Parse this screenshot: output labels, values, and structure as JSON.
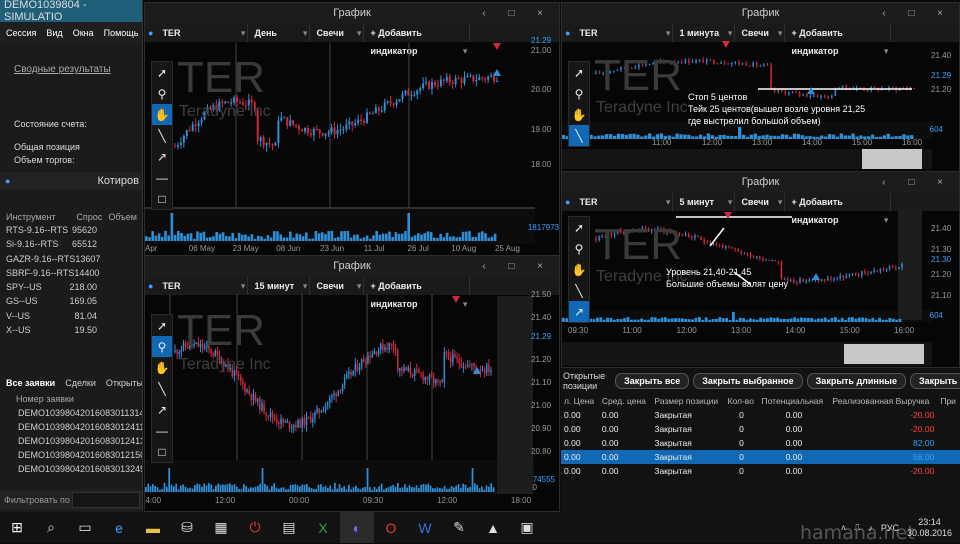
{
  "app": {
    "title": "DEMO1039804 - SIMULATIO",
    "menu": [
      "Сессия",
      "Вид",
      "Окна",
      "Помощь"
    ]
  },
  "left": {
    "summary_link": "Сводные результаты",
    "account_state": "Состояние счета:",
    "total_position": "Общая позиция",
    "trade_volume": "Объем торгов:",
    "quotes_title": "Котиров",
    "quotes_headers": [
      "Инструмент",
      "Спрос",
      "Объем"
    ],
    "quotes": [
      {
        "inst": "RTS-9.16--RTS",
        "bid": "95620"
      },
      {
        "inst": "Si-9.16--RTS",
        "bid": "65512"
      },
      {
        "inst": "GAZR-9.16--RTS",
        "bid": "13607"
      },
      {
        "inst": "SBRF-9.16--RTS",
        "bid": "14400"
      },
      {
        "inst": "SPY--US",
        "bid": "218.00"
      },
      {
        "inst": "GS--US",
        "bid": "169.05"
      },
      {
        "inst": "V--US",
        "bid": "81.04"
      },
      {
        "inst": "X--US",
        "bid": "19.50"
      }
    ],
    "orders_tabs": [
      "Все заявки",
      "Сделки",
      "Открытые"
    ],
    "orders_header": "Номер заявки",
    "orders": [
      "DEMO10398042016083011314",
      "DEMO10398042016083012411",
      "DEMO10398042016083012413",
      "DEMO10398042016083012150",
      "DEMO10398042016083013245"
    ],
    "filter_label": "Фильтровать по"
  },
  "charts": {
    "window_title": "График",
    "add_indicator": "+ Добавить индикатор",
    "candles": "Свечи",
    "symbol": "TER",
    "company": "Teradyne Inc",
    "c1": {
      "period": "День",
      "yticks": [
        "21.00",
        "20.00",
        "19.00",
        "18.00"
      ],
      "price": "21.29",
      "vol": "1817973",
      "xticks": [
        "Apr",
        "06 May",
        "23 May",
        "08 Jun",
        "23 Jun",
        "11 Jul",
        "26 Jul",
        "10 Aug",
        "25 Aug"
      ]
    },
    "c2": {
      "period": "15 минут",
      "yticks": [
        "21.50",
        "21.40",
        "21.30",
        "21.20",
        "21.10",
        "21.00",
        "20.90",
        "20.80"
      ],
      "price": "21.29",
      "vol": "74555",
      "vol_zero": "0",
      "xticks": [
        "14:00",
        "12:00",
        "00:00",
        "09:30",
        "12:00",
        "18:00"
      ]
    },
    "c3": {
      "period": "1 минута",
      "yticks": [
        "21.40",
        "21.30",
        "21.20"
      ],
      "price": "21.29",
      "vol": "604",
      "xticks": [
        "11:00",
        "12:00",
        "13:00",
        "14:00",
        "15:00",
        "16:00"
      ],
      "note": [
        "Стоп 5 центов",
        "Тейк 25 центов(вышел возле уровня 21,25",
        "где выстрелил большой объем)"
      ]
    },
    "c4": {
      "period": "5 минут",
      "yticks": [
        "21.40",
        "21.30",
        "21.20",
        "21.10"
      ],
      "price": "21.30",
      "vol": "604",
      "xticks": [
        "09:30",
        "11:00",
        "12:00",
        "13:00",
        "14:00",
        "15:00",
        "16:00"
      ],
      "note": [
        "Уровень 21,40-21,45",
        "Большие объемы валят цену"
      ]
    }
  },
  "positions": {
    "title": "Открытые позиции",
    "buttons": [
      "Закрыть все",
      "Закрыть выбранное",
      "Закрыть длинные",
      "Закрыть кор"
    ],
    "headers": [
      "л. Цена",
      "Сред. цена",
      "Размер позиции",
      "Кол-во",
      "Потенциальная",
      "Реализованная Выручка",
      "При"
    ],
    "rows": [
      [
        "0.00",
        "0.00",
        "Закрытая",
        "0",
        "0.00",
        "-20.00"
      ],
      [
        "0.00",
        "0.00",
        "Закрытая",
        "0",
        "0.00",
        "-20.00"
      ],
      [
        "0.00",
        "0.00",
        "Закрытая",
        "0",
        "0.00",
        "82.00"
      ],
      [
        "0.00",
        "0.00",
        "Закрытая",
        "0",
        "0.00",
        "56.00"
      ],
      [
        "0.00",
        "0.00",
        "Закрытая",
        "0",
        "0.00",
        "-20.00"
      ]
    ],
    "row_colors": [
      "#ff4040",
      "#ff4040",
      "#3aa0ff",
      "#3aa0ff",
      "#ff4040"
    ],
    "selected_row": 3
  },
  "taskbar": {
    "lang": "РУС",
    "time": "23:14",
    "date": "30.08.2016"
  },
  "watermark": "hamana.net",
  "colors": {
    "accent": "#1168b5",
    "up": "#2f8fd6",
    "down": "#d0283c",
    "bg": "#060606"
  }
}
